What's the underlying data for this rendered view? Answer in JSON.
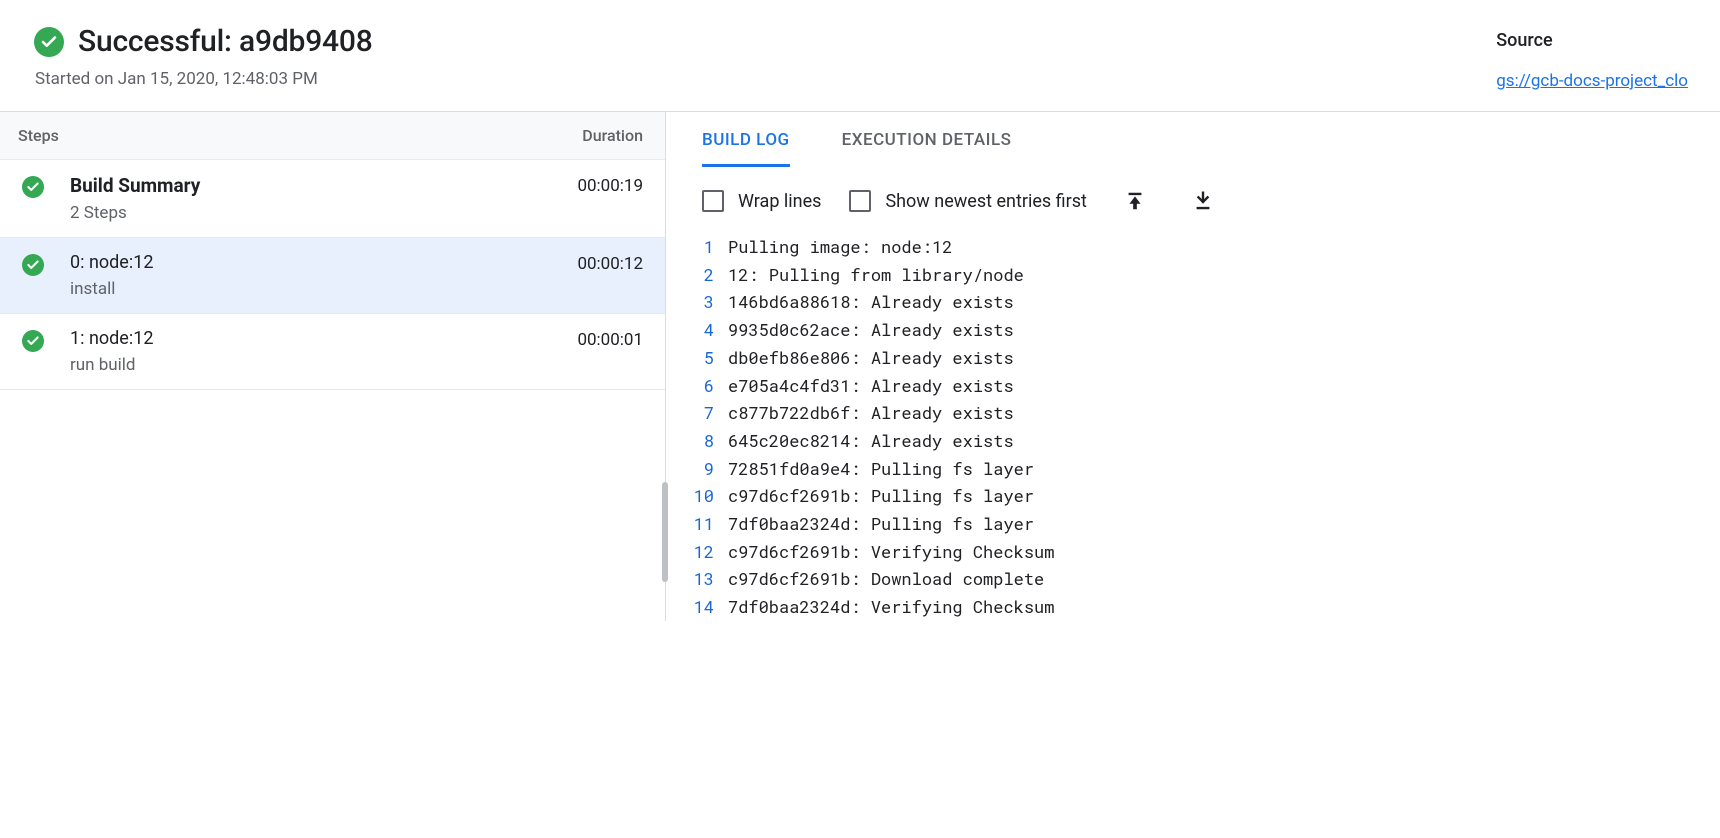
{
  "header": {
    "status_title": "Successful: a9db9408",
    "started": "Started on Jan 15, 2020, 12:48:03 PM",
    "source_label": "Source",
    "source_link": "gs://gcb-docs-project_clo"
  },
  "steps_panel": {
    "col_steps": "Steps",
    "col_duration": "Duration",
    "summary": {
      "title": "Build Summary",
      "sub": "2 Steps",
      "duration": "00:00:19"
    },
    "steps": [
      {
        "title": "0: node:12",
        "sub": "install",
        "duration": "00:00:12",
        "selected": true
      },
      {
        "title": "1: node:12",
        "sub": "run build",
        "duration": "00:00:01",
        "selected": false
      }
    ]
  },
  "tabs": {
    "build_log": "BUILD LOG",
    "execution_details": "EXECUTION DETAILS"
  },
  "toolbar": {
    "wrap_lines": "Wrap lines",
    "newest_first": "Show newest entries first"
  },
  "log": [
    "Pulling image: node:12",
    "12: Pulling from library/node",
    "146bd6a88618: Already exists",
    "9935d0c62ace: Already exists",
    "db0efb86e806: Already exists",
    "e705a4c4fd31: Already exists",
    "c877b722db6f: Already exists",
    "645c20ec8214: Already exists",
    "72851fd0a9e4: Pulling fs layer",
    "c97d6cf2691b: Pulling fs layer",
    "7df0baa2324d: Pulling fs layer",
    "c97d6cf2691b: Verifying Checksum",
    "c97d6cf2691b: Download complete",
    "7df0baa2324d: Verifying Checksum"
  ]
}
